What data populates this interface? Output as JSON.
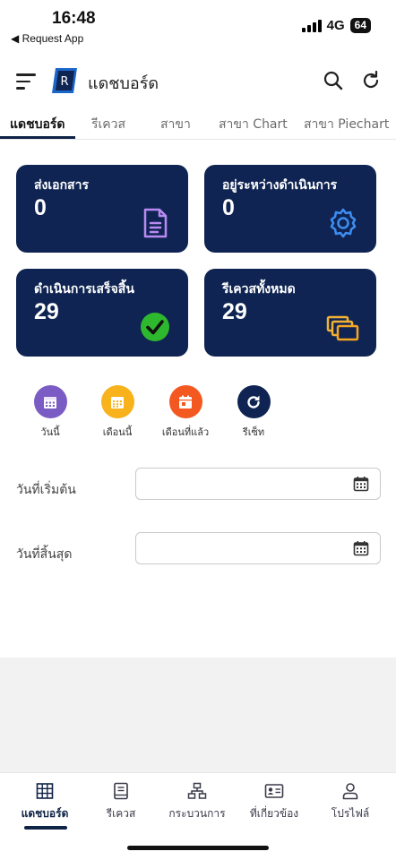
{
  "status_bar": {
    "time": "16:48",
    "back_app": "◀ Request App",
    "network": "4G",
    "battery": "64"
  },
  "app_bar": {
    "title": "แดชบอร์ด",
    "logo_letter": "R"
  },
  "tabs": [
    {
      "label": "แดชบอร์ด",
      "active": true
    },
    {
      "label": "รีเควส"
    },
    {
      "label": "สาขา"
    },
    {
      "label": "สาขา Chart"
    },
    {
      "label": "สาขา Piechart"
    }
  ],
  "cards": [
    {
      "label": "ส่งเอกสาร",
      "value": "0",
      "icon": "document-icon"
    },
    {
      "label": "อยู่ระหว่างดำเนินการ",
      "value": "0",
      "icon": "gear-icon"
    },
    {
      "label": "ดำเนินการเสร็จสิ้น",
      "value": "29",
      "icon": "check-circle-icon"
    },
    {
      "label": "รีเควสทั้งหมด",
      "value": "29",
      "icon": "stacked-folders-icon"
    }
  ],
  "quick_filters": [
    {
      "label": "วันนี้",
      "color": "#7b5cc4"
    },
    {
      "label": "เดือนนี้",
      "color": "#f7b21c"
    },
    {
      "label": "เดือนที่แล้ว",
      "color": "#f2581f"
    },
    {
      "label": "รีเซ็ท",
      "color": "#0f2452"
    }
  ],
  "date_filters": {
    "start_label": "วันที่เริ่มต้น",
    "start_value": "",
    "end_label": "วันที่สิ้นสุด",
    "end_value": ""
  },
  "bottom_nav": [
    {
      "label": "แดชบอร์ด",
      "icon": "grid-icon",
      "active": true
    },
    {
      "label": "รีเควส",
      "icon": "book-icon"
    },
    {
      "label": "กระบวนการ",
      "icon": "sitemap-icon"
    },
    {
      "label": "ที่เกี่ยวข้อง",
      "icon": "id-card-icon"
    },
    {
      "label": "โปรไฟล์",
      "icon": "user-icon"
    }
  ],
  "colors": {
    "primary": "#0f2452",
    "accent_blue": "#1b66c9"
  }
}
